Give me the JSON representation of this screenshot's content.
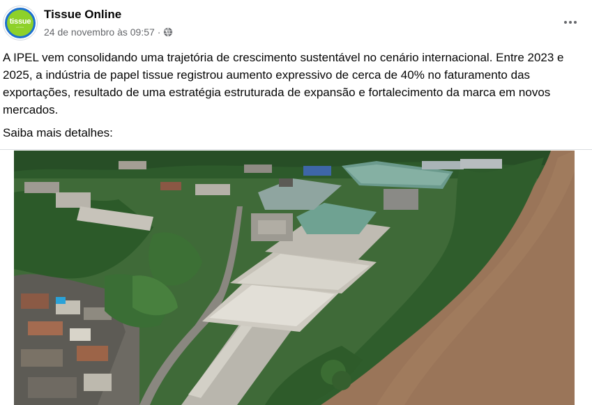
{
  "post": {
    "page_name": "Tissue Online",
    "timestamp": "24 de novembro às 09:57",
    "separator": "·",
    "privacy_icon": "globe-icon",
    "more_icon": "more-horizontal-icon",
    "avatar_logo_text": "tissue",
    "avatar_logo_subtext": "online",
    "body_text": "A IPEL vem consolidando uma trajetória de crescimento sustentável no cenário internacional. Entre 2023 e 2025, a indústria de papel tissue registrou aumento expressivo de cerca de 40% no faturamento das exportações, resultado de uma estratégia estruturada de expansão e fortalecimento da marca em novos mercados.",
    "more_details": "Saiba mais detalhes:"
  },
  "colors": {
    "avatar_ring": "#1b6fd0",
    "avatar_fill": "#8ed12a",
    "secondary_text": "#65676b"
  }
}
